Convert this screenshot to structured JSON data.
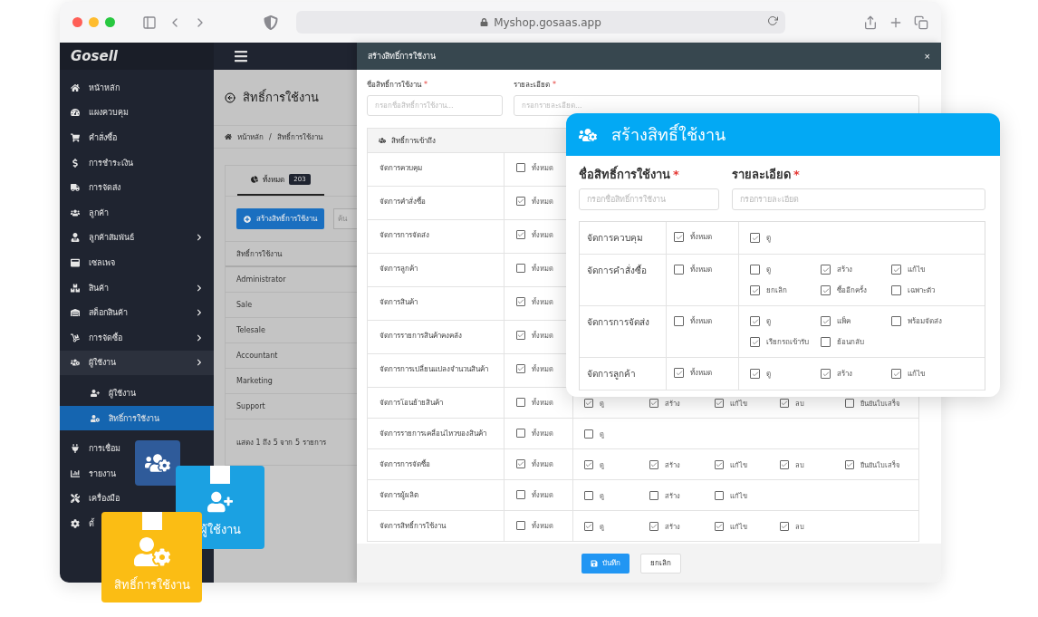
{
  "browser": {
    "url": "Myshop.gosaas.app"
  },
  "sidebar": {
    "logo": "Gosell",
    "items": [
      {
        "label": "หน้าหลัก",
        "submenu": false,
        "selected": false
      },
      {
        "label": "แผงควบคุม",
        "submenu": false,
        "selected": false
      },
      {
        "label": "คำสั่งซื้อ",
        "submenu": false,
        "selected": false
      },
      {
        "label": "การชำระเงิน",
        "submenu": false,
        "selected": false
      },
      {
        "label": "การจัดส่ง",
        "submenu": false,
        "selected": false
      },
      {
        "label": "ลูกค้า",
        "submenu": false,
        "selected": false
      },
      {
        "label": "ลูกค้าสัมพันธ์",
        "submenu": true,
        "selected": false
      },
      {
        "label": "เซลเพจ",
        "submenu": false,
        "selected": false
      },
      {
        "label": "สินค้า",
        "submenu": true,
        "selected": false
      },
      {
        "label": "สต็อกสินค้า",
        "submenu": true,
        "selected": false
      },
      {
        "label": "การจัดซื้อ",
        "submenu": true,
        "selected": false
      },
      {
        "label": "ผู้ใช้งาน",
        "submenu": true,
        "selected": true,
        "children": [
          {
            "label": "ผู้ใช้งาน",
            "selected": false
          },
          {
            "label": "สิทธิ์การใช้งาน",
            "selected": true
          }
        ]
      },
      {
        "label": "การเชื่อม",
        "submenu": false,
        "selected": false
      },
      {
        "label": "รายงาน",
        "submenu": false,
        "selected": false
      },
      {
        "label": "เครื่องมือ",
        "submenu": false,
        "selected": false
      },
      {
        "label": "ตั้",
        "submenu": false,
        "selected": false
      }
    ]
  },
  "page": {
    "title": "สิทธิ์การใช้งาน",
    "breadcrumb": [
      "หน้าหลัก",
      "/",
      "สิทธิ์การใช้งาน"
    ],
    "tab": {
      "label": "ทั้งหมด",
      "count": "203",
      "selected": true
    },
    "create_button": "สร้างสิทธิ์การใช้งาน",
    "search": {
      "placeholder": "ค้น"
    },
    "table": {
      "columns": [
        "สิทธิ์การใช้งาน"
      ],
      "rows": [
        "Administrator",
        "Sale",
        "Telesale",
        "Accountant",
        "Marketing",
        "Support"
      ]
    },
    "footer": "แสดง 1 ถึง 5 จาก 5 รายการ"
  },
  "modal": {
    "title": "สร้างสิทธิ์การใช้งาน",
    "close": "×",
    "fields": [
      {
        "label": "ชื่อสิทธิ์การใช้งาน",
        "required": "*",
        "placeholder": "กรอกชื่อสิทธิ์การใช้งาน..."
      },
      {
        "label": "รายละเอียด",
        "required": "*",
        "placeholder": "กรอกรายละเอียด..."
      }
    ],
    "section": "สิทธิ์การเข้าถึง",
    "rows": [
      {
        "name": "จัดการควบคุม",
        "all_label": "ทั้งหมด",
        "all_checked": false,
        "options": []
      },
      {
        "name": "จัดการคำสั่งซื้อ",
        "all_label": "ทั้งหมด",
        "all_checked": true,
        "options": []
      },
      {
        "name": "จัดการการจัดส่ง",
        "all_label": "ทั้งหมด",
        "all_checked": true,
        "options": []
      },
      {
        "name": "จัดการลูกค้า",
        "all_label": "ทั้งหมด",
        "all_checked": false,
        "options": []
      },
      {
        "name": "จัดการสินค้า",
        "all_label": "ทั้งหมด",
        "all_checked": true,
        "options": []
      },
      {
        "name": "จัดการรายการสินค้าคงคลัง",
        "all_label": "ทั้งหมด",
        "all_checked": true,
        "options": []
      },
      {
        "name": "จัดการการเปลี่ยนแปลงจำนวนสินค้า",
        "all_label": "ทั้งหมด",
        "all_checked": true,
        "options": []
      },
      {
        "name": "จัดการโอนย้ายสินค้า",
        "all_label": "ทั้งหมด",
        "all_checked": false,
        "options": [
          {
            "label": "ดู",
            "checked": true
          },
          {
            "label": "สร้าง",
            "checked": true
          },
          {
            "label": "แก้ไข",
            "checked": true
          },
          {
            "label": "ลบ",
            "checked": true
          },
          {
            "label": "ยืนยันใบเสร็จ",
            "checked": false
          }
        ]
      },
      {
        "name": "จัดการรายการเคลื่อนไหวของสินค้า",
        "all_label": "ทั้งหมด",
        "all_checked": false,
        "options": [
          {
            "label": "ดู",
            "checked": false
          }
        ]
      },
      {
        "name": "จัดการการจัดซื้อ",
        "all_label": "ทั้งหมด",
        "all_checked": true,
        "options": [
          {
            "label": "ดู",
            "checked": true
          },
          {
            "label": "สร้าง",
            "checked": true
          },
          {
            "label": "แก้ไข",
            "checked": true
          },
          {
            "label": "ลบ",
            "checked": true
          },
          {
            "label": "ยืนยันใบเสร็จ",
            "checked": true
          }
        ]
      },
      {
        "name": "จัดการผู้ผลิต",
        "all_label": "ทั้งหมด",
        "all_checked": false,
        "options": [
          {
            "label": "ดู",
            "checked": false
          },
          {
            "label": "สร้าง",
            "checked": false
          },
          {
            "label": "แก้ไข",
            "checked": false
          }
        ]
      },
      {
        "name": "จัดการสิทธิ์การใช้งาน",
        "all_label": "ทั้งหมด",
        "all_checked": false,
        "options": [
          {
            "label": "ดู",
            "checked": true
          },
          {
            "label": "สร้าง",
            "checked": true
          },
          {
            "label": "แก้ไข",
            "checked": true
          },
          {
            "label": "ลบ",
            "checked": true
          }
        ]
      }
    ],
    "buttons": {
      "save": "บันทึก",
      "cancel": "ยกเลิก"
    }
  },
  "card": {
    "title": "สร้างสิทธิ์ใช้งาน",
    "fields": [
      {
        "label": "ชื่อสิทธิ์การใช้งาน",
        "required": "*",
        "placeholder": "กรอกชื่อสิทธิ์การใช้งาน"
      },
      {
        "label": "รายละเอียด",
        "required": "*",
        "placeholder": "กรอกรายละเอียด"
      }
    ],
    "rows": [
      {
        "name": "จัดการควบคุม",
        "all_label": "ทั้งหมด",
        "all_checked": true,
        "options": [
          {
            "label": "ดู",
            "checked": true
          }
        ]
      },
      {
        "name": "จัดการคำสั่งซื้อ",
        "all_label": "ทั้งหมด",
        "all_checked": false,
        "options": [
          {
            "label": "ดู",
            "checked": false
          },
          {
            "label": "สร้าง",
            "checked": true
          },
          {
            "label": "แก้ไข",
            "checked": true
          },
          {
            "label": "ยกเลิก",
            "checked": true
          },
          {
            "label": "ซื้ออีกครั้ง",
            "checked": true
          },
          {
            "label": "เฉพาะตัว",
            "checked": false
          }
        ]
      },
      {
        "name": "จัดการการจัดส่ง",
        "all_label": "ทั้งหมด",
        "all_checked": false,
        "options": [
          {
            "label": "ดู",
            "checked": true
          },
          {
            "label": "แพ็ค",
            "checked": true
          },
          {
            "label": "พร้อมจัดส่ง",
            "checked": false
          },
          {
            "label": "เรียกรถเข้ารับ",
            "checked": true
          },
          {
            "label": "ย้อนกลับ",
            "checked": false
          }
        ]
      },
      {
        "name": "จัดการลูกค้า",
        "all_label": "ทั้งหมด",
        "all_checked": true,
        "options": [
          {
            "label": "ดู",
            "checked": true
          },
          {
            "label": "สร้าง",
            "checked": true
          },
          {
            "label": "แก้ไข",
            "checked": true
          }
        ]
      }
    ]
  },
  "tiles": [
    {
      "kind": "icon"
    },
    {
      "kind": "labeled",
      "label": "ผู้ใช้งาน"
    },
    {
      "kind": "labeled",
      "label": "สิทธิ์การใช้งาน"
    }
  ]
}
